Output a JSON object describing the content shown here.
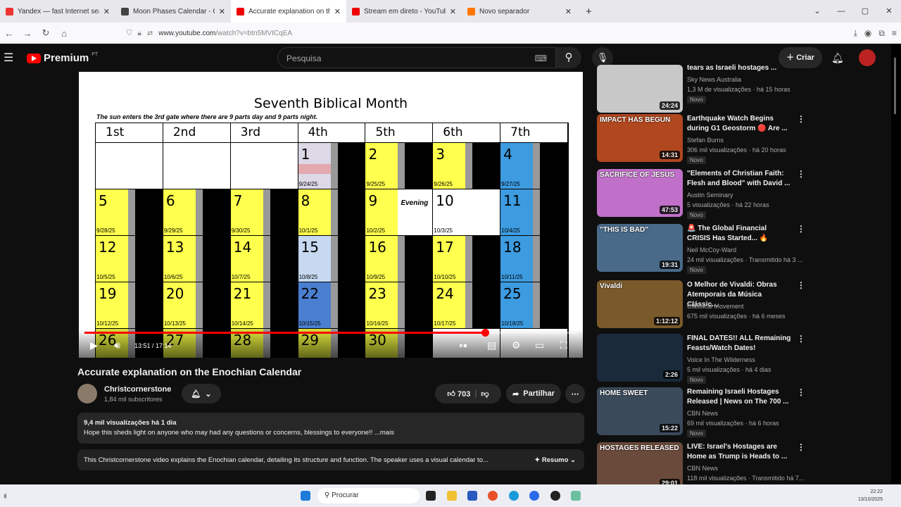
{
  "browser": {
    "tabs": [
      {
        "label": "Yandex — fast Internet search",
        "color": "#e33"
      },
      {
        "label": "Moon Phases Calendar - October",
        "color": "#444"
      },
      {
        "label": "Accurate explanation on the Enochian Calendar",
        "color": "#e00",
        "active": true
      },
      {
        "label": "Stream em direto - YouTube Studio",
        "color": "#e00"
      },
      {
        "label": "Novo separador",
        "color": "#f70"
      }
    ],
    "url_domain": "www.youtube.com",
    "url_path": "/watch?v=btn5MVICqEA"
  },
  "yt": {
    "logo": "Premium",
    "region": "PT",
    "search_placeholder": "Pesquisa",
    "create": "Criar"
  },
  "video": {
    "title": "Seventh Biblical Month",
    "subtitle": "The sun enters the 3rd gate where there are 9 parts day and 9 parts night.",
    "headers": [
      "1st",
      "2nd",
      "3rd",
      "4th",
      "5th",
      "6th",
      "7th"
    ],
    "rows": [
      [
        null,
        null,
        null,
        {
          "n": "1",
          "d": "9/24/25",
          "c": "#dcd8e6",
          "pink": true
        },
        {
          "n": "2",
          "d": "9/25/25",
          "c": "#ffff4d"
        },
        {
          "n": "3",
          "d": "9/26/25",
          "c": "#ffff4d"
        },
        {
          "n": "4",
          "d": "9/27/25",
          "c": "#3d9be0"
        }
      ],
      [
        {
          "n": "5",
          "d": "9/28/25",
          "c": "#ffff4d"
        },
        {
          "n": "6",
          "d": "9/29/25",
          "c": "#ffff4d"
        },
        {
          "n": "7",
          "d": "9/30/25",
          "c": "#ffff4d"
        },
        {
          "n": "8",
          "d": "10/1/25",
          "c": "#ffff4d"
        },
        {
          "n": "9",
          "d": "10/2/25",
          "c": "#ffff4d",
          "ev": "Evening"
        },
        {
          "n": "10",
          "d": "10/3/25",
          "c": "#fff",
          "white": true
        },
        {
          "n": "11",
          "d": "10/4/25",
          "c": "#3d9be0"
        }
      ],
      [
        {
          "n": "12",
          "d": "10/5/25",
          "c": "#ffff4d"
        },
        {
          "n": "13",
          "d": "10/6/25",
          "c": "#ffff4d"
        },
        {
          "n": "14",
          "d": "10/7/25",
          "c": "#ffff4d"
        },
        {
          "n": "15",
          "d": "10/8/25",
          "c": "#c6d9f0"
        },
        {
          "n": "16",
          "d": "10/9/25",
          "c": "#ffff4d"
        },
        {
          "n": "17",
          "d": "10/10/25",
          "c": "#ffff4d"
        },
        {
          "n": "18",
          "d": "10/11/25",
          "c": "#3d9be0"
        }
      ],
      [
        {
          "n": "19",
          "d": "10/12/25",
          "c": "#ffff4d"
        },
        {
          "n": "20",
          "d": "10/13/25",
          "c": "#ffff4d"
        },
        {
          "n": "21",
          "d": "10/14/25",
          "c": "#ffff4d"
        },
        {
          "n": "22",
          "d": "10/15/25",
          "c": "#4a7fd0"
        },
        {
          "n": "23",
          "d": "10/16/25",
          "c": "#ffff4d"
        },
        {
          "n": "24",
          "d": "10/17/25",
          "c": "#ffff4d"
        },
        {
          "n": "25",
          "d": "10/18/25",
          "c": "#3d9be0"
        }
      ],
      [
        {
          "n": "26",
          "c": "#d8df3a"
        },
        {
          "n": "27",
          "c": "#d8df3a"
        },
        {
          "n": "28",
          "c": "#d8df3a"
        },
        {
          "n": "29",
          "c": "#d8df3a"
        },
        {
          "n": "30",
          "c": "#d8df3a"
        },
        null,
        null
      ]
    ],
    "time": "13:51 / 17:14",
    "progress": 0.813
  },
  "meta": {
    "title": "Accurate explanation on the Enochian Calendar",
    "channel": "Christcornerstone",
    "subs": "1,84 mil subscritores",
    "likes": "703",
    "share": "Partilhar",
    "views_date": "9,4 mil visualizações  há 1 dia",
    "description": "Hope this sheds light on anyone who may had any questions or concerns, blessings to everyone!! ...mais",
    "summary": "This Christcornerstone video explains the Enochian calendar, detailing its structure and function. The speaker uses a visual calendar to...",
    "summary_btn": "✦ Resumo"
  },
  "related": [
    {
      "title": "tears as Israeli hostages ...",
      "channel": "Sky News Australia",
      "meta": "1,3 M de visualizações · há 15 horas",
      "dur": "24:24",
      "novo": "Novo",
      "bg": "#c8c8c8"
    },
    {
      "title": "Earthquake Watch Begins during G1 Geostorm 🔴 Are ...",
      "channel": "Stefan Burns",
      "meta": "306 mil visualizações · há 20 horas",
      "dur": "14:31",
      "novo": "Novo",
      "bg": "#b0471f",
      "thumb_text": "IMPACT HAS BEGUN"
    },
    {
      "title": "\"Elements of Christian Faith: Flesh and Blood\" with David ...",
      "channel": "Austin Seminary",
      "meta": "5 visualizações · há 22 horas",
      "dur": "47:53",
      "novo": "Novo",
      "bg": "#c070c8",
      "thumb_text": "SACRIFICE OF JESUS"
    },
    {
      "title": "🚨 The Global Financial CRISIS Has Started... 🔥",
      "channel": "Neil McCoy-Ward",
      "meta": "24 mil visualizações · Transmitido há 3 ...",
      "dur": "19:31",
      "novo": "Novo",
      "bg": "#4a6a8a",
      "thumb_text": "\"THIS IS BAD\""
    },
    {
      "title": "O Melhor de Vivaldi: Obras Atemporais da Música Clássic...",
      "channel": "Classical Movement",
      "meta": "675 mil visualizações · há 6 meses",
      "dur": "1:12:12",
      "bg": "#7a5a2a",
      "thumb_text": "Vivaldi"
    },
    {
      "title": "FINAL DATES!! ALL Remaining Feasts/Watch Dates!",
      "channel": "Voice In The Wilderness",
      "meta": "5 mil visualizações · há 4 dias",
      "dur": "2:26",
      "novo": "Novo",
      "bg": "#1a2a3a"
    },
    {
      "title": "Remaining Israeli Hostages Released | News on The 700 ...",
      "channel": "CBN News",
      "meta": "69 mil visualizações · há 6 horas",
      "dur": "15:22",
      "novo": "Novo",
      "bg": "#3a4a5a",
      "thumb_text": "HOME SWEET"
    },
    {
      "title": "LIVE: Israel's Hostages are Home as Trump is Heads to ...",
      "channel": "CBN News",
      "meta": "118 mil visualizações · Transmitido há 7...",
      "dur": "29:01",
      "bg": "#6a4a3a",
      "thumb_text": "HOSTAGES RELEASED"
    }
  ],
  "taskbar": {
    "search": "Procurar",
    "time": "22:22",
    "date": "13/10/2025"
  }
}
